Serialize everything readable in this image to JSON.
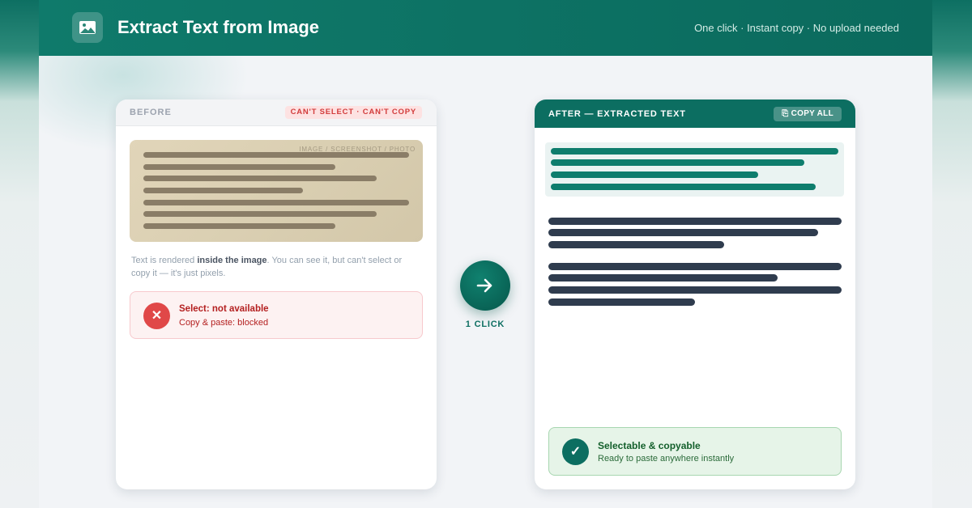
{
  "header": {
    "title": "Extract Text from Image",
    "tagline": "One click · Instant copy · No upload needed",
    "logo_icon": "image-icon"
  },
  "before": {
    "label": "BEFORE",
    "badge": "CAN'T SELECT · CAN'T COPY",
    "image_caption": "IMAGE / SCREENSHOT / PHOTO",
    "description_prefix": "Text is rendered ",
    "description_bold": "inside the image",
    "description_suffix": ". You can see it, but can't select or copy it — it's just pixels.",
    "status_icon": "close-icon",
    "status_title": "Select: not available",
    "status_subtitle": "Copy & paste: blocked"
  },
  "action": {
    "arrow_icon": "arrow-right-icon",
    "label": "1 CLICK"
  },
  "after": {
    "label": "AFTER — EXTRACTED TEXT",
    "copy_icon": "clipboard-icon",
    "copy_label": "COPY ALL",
    "status_icon": "check-icon",
    "status_title": "Selectable & copyable",
    "status_subtitle": "Ready to paste anywhere instantly"
  },
  "colors": {
    "brand": "#0c6e61",
    "error": "#e04848",
    "success_bg": "#e6f4e8"
  }
}
